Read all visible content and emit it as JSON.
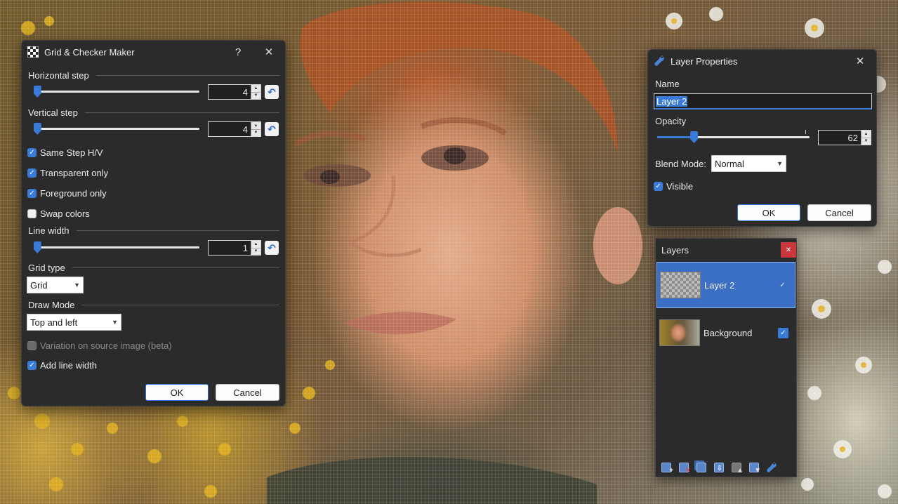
{
  "grid_dialog": {
    "title": "Grid & Checker Maker",
    "help": "?",
    "close": "✕",
    "horizontal_step": {
      "label": "Horizontal step",
      "value": "4",
      "level": 0.02
    },
    "vertical_step": {
      "label": "Vertical step",
      "value": "4",
      "level": 0.02
    },
    "same_step": {
      "label": "Same Step H/V",
      "checked": true
    },
    "transparent_only": {
      "label": "Transparent only",
      "checked": true
    },
    "foreground_only": {
      "label": "Foreground only",
      "checked": true
    },
    "swap_colors": {
      "label": "Swap colors",
      "checked": false
    },
    "line_width": {
      "label": "Line width",
      "value": "1",
      "level": 0.02
    },
    "grid_type": {
      "label": "Grid type",
      "selected": "Grid"
    },
    "draw_mode": {
      "label": "Draw Mode",
      "selected": "Top and left"
    },
    "variation": {
      "label": "Variation on source image (beta)",
      "checked": false,
      "disabled": true
    },
    "add_line_width": {
      "label": "Add line width",
      "checked": true
    },
    "ok_label": "OK",
    "cancel_label": "Cancel"
  },
  "layer_properties": {
    "title": "Layer Properties",
    "close": "✕",
    "name_label": "Name",
    "name_value": "Layer 2",
    "opacity_label": "Opacity",
    "opacity_value": "62",
    "opacity_level": 0.24,
    "blend_label": "Blend Mode:",
    "blend_value": "Normal",
    "visible_label": "Visible",
    "visible_checked": true,
    "ok_label": "OK",
    "cancel_label": "Cancel"
  },
  "layers_panel": {
    "title": "Layers",
    "close": "✕",
    "layers": [
      {
        "name": "Layer 2",
        "visible": true,
        "selected": true
      },
      {
        "name": "Background",
        "visible": true,
        "selected": false
      }
    ],
    "toolbar": [
      "add-layer-icon",
      "delete-layer-icon",
      "duplicate-layer-icon",
      "merge-down-icon",
      "move-layer-up-icon",
      "move-layer-down-icon",
      "layer-properties-icon"
    ]
  },
  "colors": {
    "accent": "#3b7bd8",
    "dialog_bg": "#2b2b2b",
    "selected_row": "#3a6fc4",
    "close_red": "#c8383c"
  }
}
